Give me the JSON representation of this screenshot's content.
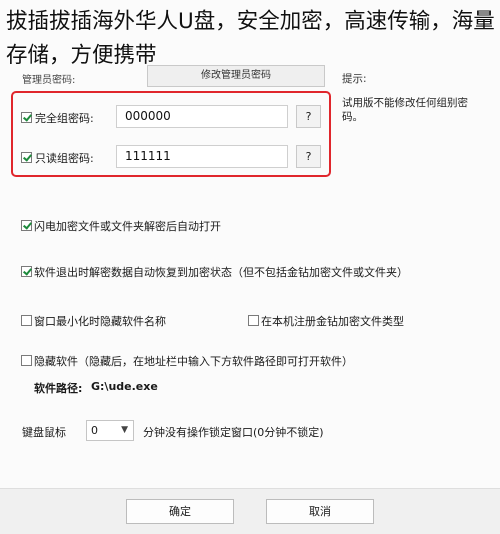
{
  "overlay_title": "拔插拔插海外华人U盘，安全加密，高速传输，海量存储，方便携带",
  "top": {
    "admin_label": "管理员密码:",
    "admin_button": "修改管理员密码",
    "hint_label": "提示:",
    "hint_text": "试用版不能修改任何组别密码。"
  },
  "groups": [
    {
      "label": "完全组密码:",
      "value": "000000",
      "help": "?"
    },
    {
      "label": "只读组密码:",
      "value": "111111",
      "help": "?"
    }
  ],
  "options": {
    "auto_open": "闪电加密文件或文件夹解密后自动打开",
    "auto_restore": "软件退出时解密数据自动恢复到加密状态（但不包括金钻加密文件或文件夹）",
    "hide_name": "窗口最小化时隐藏软件名称",
    "register_type": "在本机注册金钻加密文件类型",
    "hide_software": "隐藏软件（隐藏后，在地址栏中输入下方软件路径即可打开软件）",
    "path_label": "软件路径:",
    "path_value": "G:\\ude.exe"
  },
  "lock": {
    "label": "键盘鼠标",
    "value": "0",
    "suffix": "分钟没有操作锁定窗口(0分钟不锁定)"
  },
  "footer": {
    "ok": "确定",
    "cancel": "取消"
  }
}
